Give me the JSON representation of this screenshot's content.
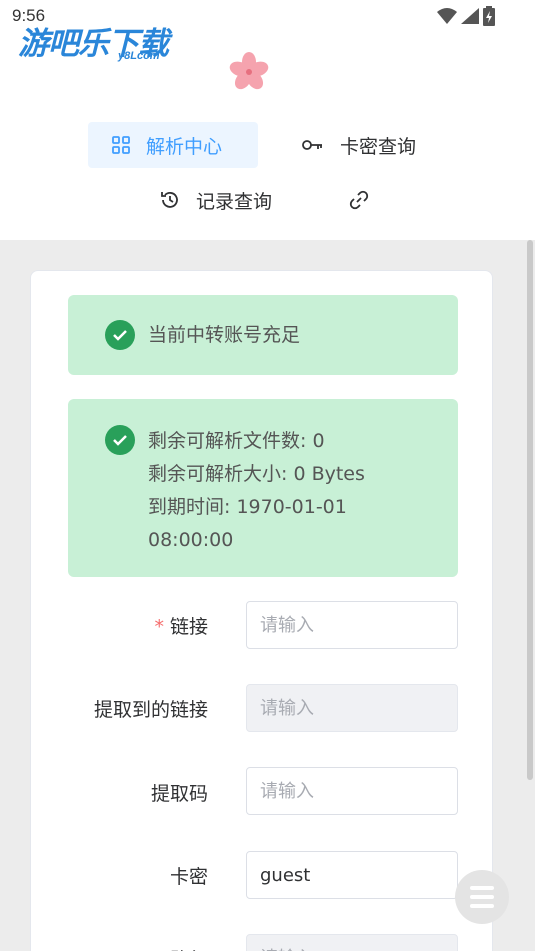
{
  "status_bar": {
    "time": "9:56"
  },
  "watermark": {
    "main": "游吧乐下载",
    "sub": "y8Lcom"
  },
  "nav": {
    "parse_center": "解析中心",
    "card_query": "卡密查询",
    "record_query": "记录查询"
  },
  "alerts": {
    "account_status": "当前中转账号充足",
    "remaining_files": "剩余可解析文件数: 0",
    "remaining_size": "剩余可解析大小: 0 Bytes",
    "expire_line1": "到期时间: 1970-01-01",
    "expire_line2": "08:00:00"
  },
  "form": {
    "required_mark": "*",
    "link_label": "链接",
    "link_placeholder": "请输入",
    "extracted_label": "提取到的链接",
    "extracted_placeholder": "请输入",
    "code_label": "提取码",
    "code_placeholder": "请输入",
    "card_label": "卡密",
    "card_value": "guest",
    "path_label": "路径",
    "path_placeholder": "请输入"
  },
  "colors": {
    "accent": "#409eff",
    "success_bg": "#c8f0d6",
    "success_icon": "#29a05a",
    "required": "#f56c6c"
  }
}
